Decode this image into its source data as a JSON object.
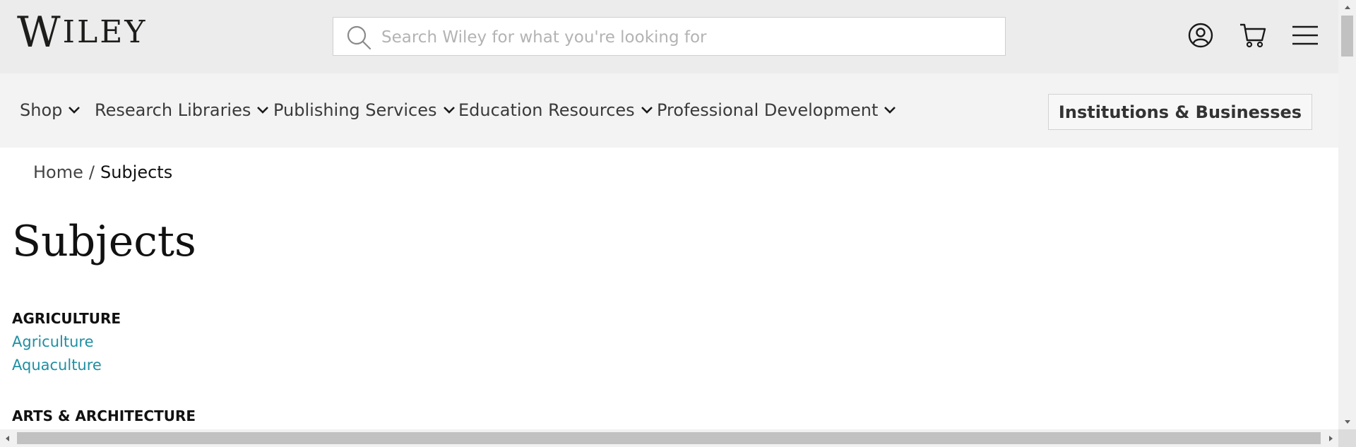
{
  "header": {
    "logo_first": "W",
    "logo_rest": "ILEY",
    "search_placeholder": "Search Wiley for what you're looking for",
    "icons": [
      "account-icon",
      "cart-icon",
      "menu-icon"
    ]
  },
  "nav": {
    "items": [
      {
        "label": "Shop"
      },
      {
        "label": "Research Libraries"
      },
      {
        "label": "Publishing Services"
      },
      {
        "label": "Education Resources"
      },
      {
        "label": "Professional Development"
      }
    ],
    "cta_label": "Institutions & Businesses"
  },
  "breadcrumb": {
    "home": "Home",
    "separator": "/",
    "current": "Subjects"
  },
  "page_title": "Subjects",
  "categories": [
    {
      "heading": "AGRICULTURE",
      "links": [
        "Agriculture",
        "Aquaculture"
      ]
    },
    {
      "heading": "ARTS & ARCHITECTURE",
      "links": []
    }
  ],
  "colors": {
    "header_bg": "#ececec",
    "nav_bg": "#f3f3f3",
    "link": "#1f8fa1",
    "text": "#1a1a1a"
  }
}
